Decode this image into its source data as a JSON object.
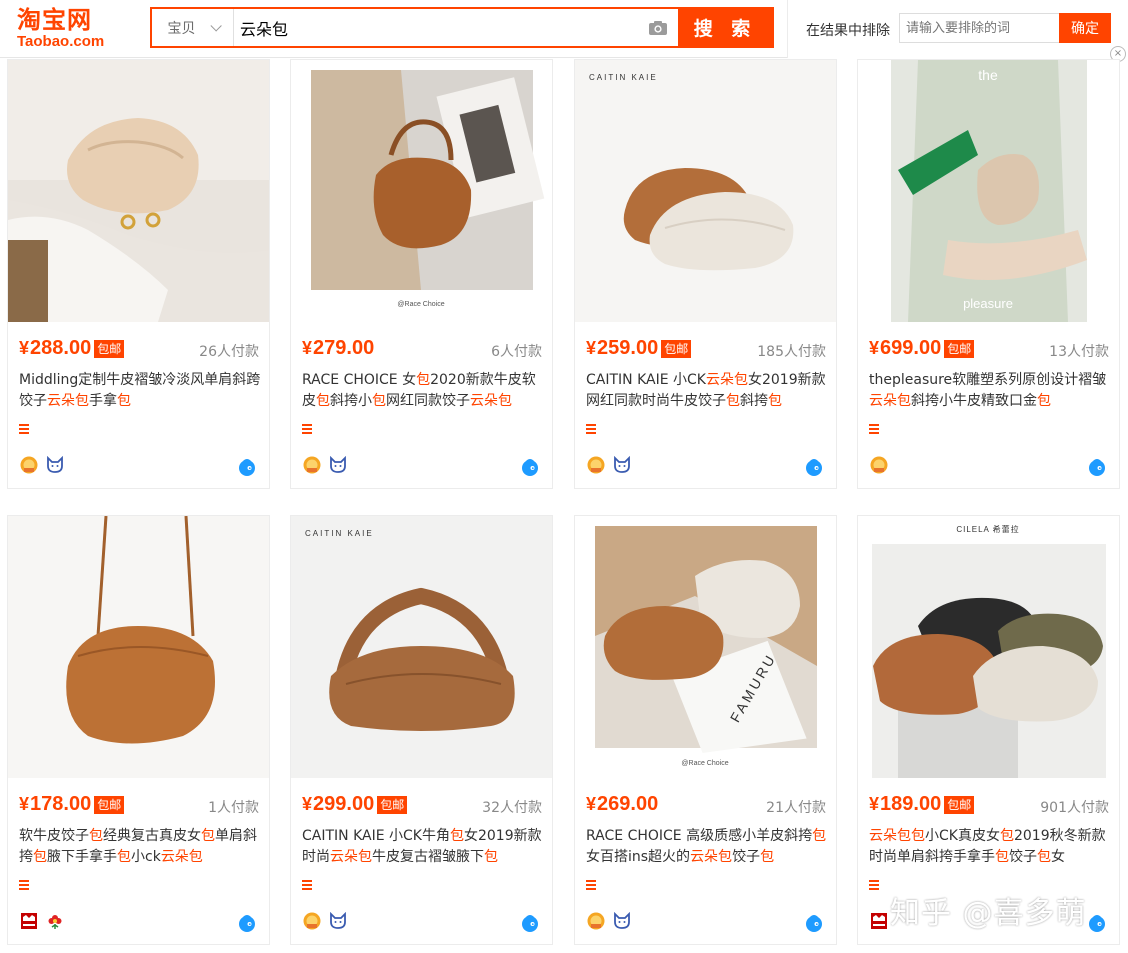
{
  "header": {
    "logo_cn": "淘宝网",
    "logo_en": "Taobao.com",
    "search_scope": "宝贝",
    "search_query": "云朵包",
    "search_button": "搜 索",
    "exclude_label": "在结果中排除",
    "exclude_placeholder": "请输入要排除的词",
    "exclude_button": "确定",
    "close": "×"
  },
  "colors": {
    "accent": "#ff4400",
    "tmall_red": "#c40000",
    "wangwang_blue": "#1e9bff",
    "gold": "#f5a623"
  },
  "products": [
    {
      "currency": "¥",
      "price": "288.00",
      "free_shipping": "包邮",
      "buyers": "26人付款",
      "title_parts": [
        {
          "t": "Middling定制牛皮褶皱冷淡风单肩斜跨饺子"
        },
        {
          "t": "云朵包",
          "hl": true
        },
        {
          "t": "手拿"
        },
        {
          "t": "包",
          "hl": true
        }
      ],
      "badges": [
        "gold-medal-icon",
        "fox-icon"
      ],
      "image_text": ""
    },
    {
      "currency": "¥",
      "price": "279.00",
      "free_shipping": "",
      "buyers": "6人付款",
      "title_parts": [
        {
          "t": "RACE CHOICE 女"
        },
        {
          "t": "包",
          "hl": true
        },
        {
          "t": "2020新款牛皮软皮"
        },
        {
          "t": "包",
          "hl": true
        },
        {
          "t": "斜挎小"
        },
        {
          "t": "包",
          "hl": true
        },
        {
          "t": "网红同款饺子"
        },
        {
          "t": "云朵包",
          "hl": true
        }
      ],
      "badges": [
        "gold-medal-icon",
        "fox-icon"
      ],
      "image_text": "@Race Choice"
    },
    {
      "currency": "¥",
      "price": "259.00",
      "free_shipping": "包邮",
      "buyers": "185人付款",
      "title_parts": [
        {
          "t": "CAITIN KAIE 小CK"
        },
        {
          "t": "云朵包",
          "hl": true
        },
        {
          "t": "女2019新款网红同款时尚牛皮饺子"
        },
        {
          "t": "包",
          "hl": true
        },
        {
          "t": "斜挎"
        },
        {
          "t": "包",
          "hl": true
        }
      ],
      "badges": [
        "gold-medal-icon",
        "fox-icon"
      ],
      "image_text": "CAITIN  KAIE"
    },
    {
      "currency": "¥",
      "price": "699.00",
      "free_shipping": "包邮",
      "buyers": "13人付款",
      "title_parts": [
        {
          "t": "thepleasure软雕塑系列原创设计褶皱"
        },
        {
          "t": "云朵包",
          "hl": true
        },
        {
          "t": "斜挎小牛皮精致口金"
        },
        {
          "t": "包",
          "hl": true
        }
      ],
      "badges": [
        "gold-medal-icon"
      ],
      "image_text": "the pleasure"
    },
    {
      "currency": "¥",
      "price": "178.00",
      "free_shipping": "包邮",
      "buyers": "1人付款",
      "title_parts": [
        {
          "t": "软牛皮饺子"
        },
        {
          "t": "包",
          "hl": true
        },
        {
          "t": "经典复古真皮女"
        },
        {
          "t": "包",
          "hl": true
        },
        {
          "t": "单肩斜挎"
        },
        {
          "t": "包",
          "hl": true
        },
        {
          "t": "腋下手拿手"
        },
        {
          "t": "包",
          "hl": true
        },
        {
          "t": "小ck"
        },
        {
          "t": "云朵包",
          "hl": true
        }
      ],
      "badges": [
        "tmall-icon",
        "flower-icon"
      ],
      "image_text": ""
    },
    {
      "currency": "¥",
      "price": "299.00",
      "free_shipping": "包邮",
      "buyers": "32人付款",
      "title_parts": [
        {
          "t": "CAITIN KAIE 小CK牛角"
        },
        {
          "t": "包",
          "hl": true
        },
        {
          "t": "女2019新款时尚"
        },
        {
          "t": "云朵包",
          "hl": true
        },
        {
          "t": "牛皮复古褶皱腋下"
        },
        {
          "t": "包",
          "hl": true
        }
      ],
      "badges": [
        "gold-medal-icon",
        "fox-icon"
      ],
      "image_text": "CAITIN  KAIE"
    },
    {
      "currency": "¥",
      "price": "269.00",
      "free_shipping": "",
      "buyers": "21人付款",
      "title_parts": [
        {
          "t": "RACE CHOICE 高级质感小羊皮斜挎"
        },
        {
          "t": "包",
          "hl": true
        },
        {
          "t": "女百搭ins超火的"
        },
        {
          "t": "云朵包",
          "hl": true
        },
        {
          "t": "饺子"
        },
        {
          "t": "包",
          "hl": true
        }
      ],
      "badges": [
        "gold-medal-icon",
        "fox-icon"
      ],
      "image_text": "@Race Choice"
    },
    {
      "currency": "¥",
      "price": "189.00",
      "free_shipping": "包邮",
      "buyers": "901人付款",
      "title_parts": [
        {
          "t": "云朵包包",
          "hl": true
        },
        {
          "t": "小CK真皮女"
        },
        {
          "t": "包",
          "hl": true
        },
        {
          "t": "2019秋冬新款时尚单肩斜挎手拿手"
        },
        {
          "t": "包",
          "hl": true
        },
        {
          "t": "饺子"
        },
        {
          "t": "包",
          "hl": true
        },
        {
          "t": "女"
        }
      ],
      "badges": [
        "tmall-icon"
      ],
      "image_text": "CILELA 希蕾拉"
    }
  ],
  "watermark": "知乎 @喜多萌"
}
